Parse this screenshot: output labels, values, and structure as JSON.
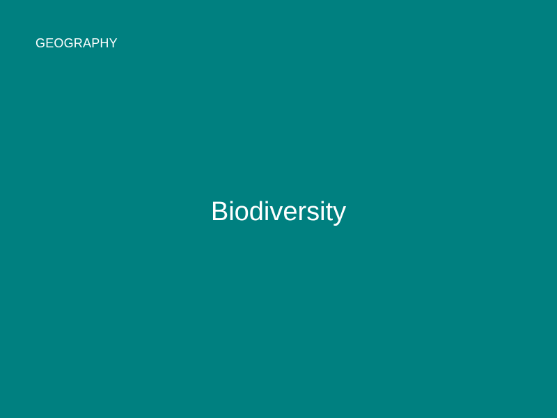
{
  "slide": {
    "subject": "GEOGRAPHY",
    "title": "Biodiversity",
    "background_color": "#008080",
    "text_color": "#ffffff"
  }
}
